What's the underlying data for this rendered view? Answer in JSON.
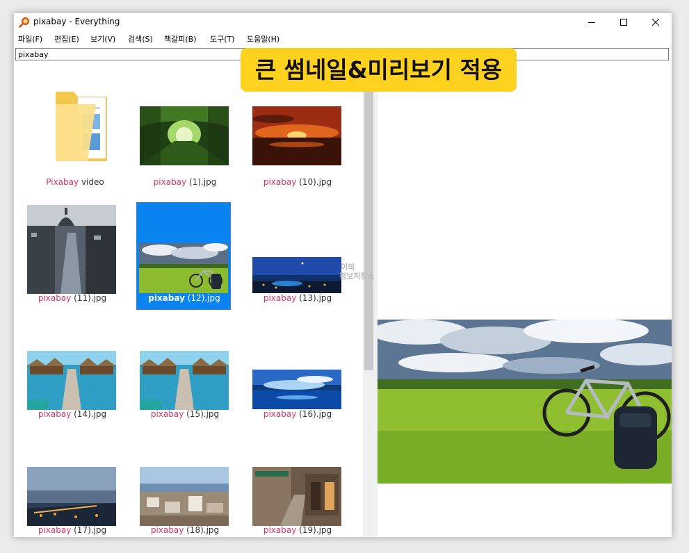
{
  "window": {
    "title": "pixabay - Everything"
  },
  "menu": [
    "파일(F)",
    "편집(E)",
    "보기(V)",
    "검색(S)",
    "책갈피(B)",
    "도구(T)",
    "도움말(H)"
  ],
  "search": {
    "value": "pixabay",
    "highlight_color": "#d6336c"
  },
  "files": [
    {
      "match": "Pixabay",
      "rest": " video",
      "kind": "folder-icon"
    },
    {
      "match": "pixabay",
      "rest": " (1).jpg"
    },
    {
      "match": "pixabay",
      "rest": " (10).jpg"
    },
    {
      "match": "pixabay",
      "rest": " (11).jpg"
    },
    {
      "match": "pixabay",
      "rest": " (12).jpg",
      "selected": true
    },
    {
      "match": "pixabay",
      "rest": " (13).jpg"
    },
    {
      "match": "pixabay",
      "rest": " (14).jpg"
    },
    {
      "match": "pixabay",
      "rest": " (15).jpg"
    },
    {
      "match": "pixabay",
      "rest": " (16).jpg"
    },
    {
      "match": "pixabay",
      "rest": " (17).jpg"
    },
    {
      "match": "pixabay",
      "rest": " (18).jpg"
    },
    {
      "match": "pixabay",
      "rest": " (19).jpg"
    }
  ],
  "selection_color": "#0a84f0",
  "banner": {
    "text": "큰 썸네일&미리보기 적용",
    "color": "#ffd21f"
  },
  "watermark": {
    "line1": "이의",
    "line2": "정보저장소"
  }
}
